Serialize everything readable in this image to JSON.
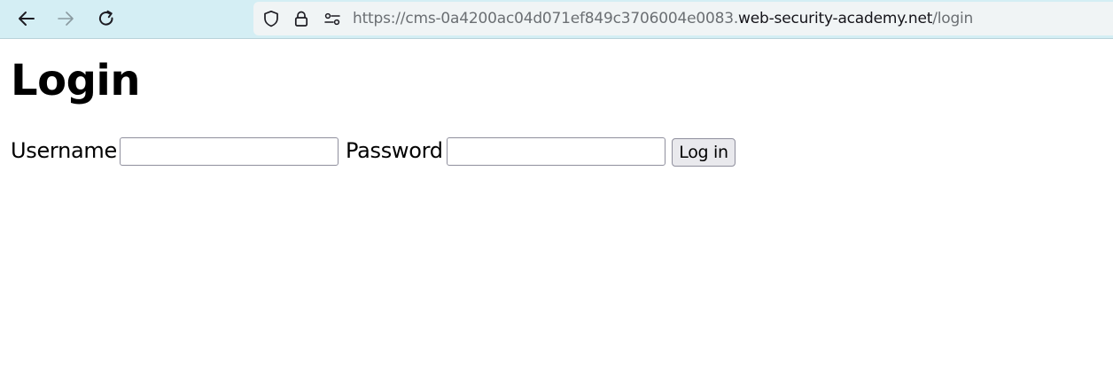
{
  "browser": {
    "url": {
      "scheme": "https://cms-0a4200ac04d071ef849c3706004e0083.",
      "host": "web-security-academy.net",
      "path": "/login"
    },
    "icons": {
      "back": "arrow-left-icon",
      "forward": "arrow-right-icon",
      "reload": "reload-icon",
      "tracking": "shield-icon",
      "security": "lock-icon",
      "permissions": "permissions-icon"
    },
    "colors": {
      "toolbar": "#d4eef4",
      "urlbar": "#f0f4f5"
    }
  },
  "page": {
    "title": "Login",
    "form": {
      "username_label": "Username",
      "username_value": "",
      "password_label": "Password",
      "password_value": "",
      "submit_label": "Log in"
    }
  }
}
